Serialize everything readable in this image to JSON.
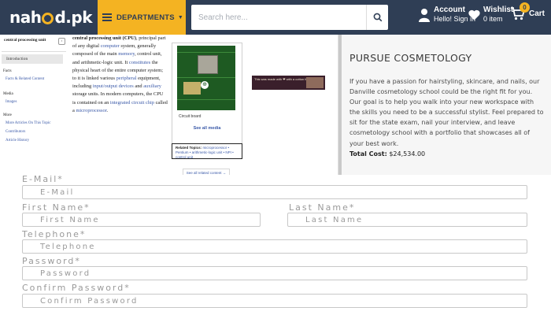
{
  "header": {
    "logo_text_pre": "nah",
    "logo_text_post": "d.pk",
    "departments_label": "DEPARTMENTS",
    "search_placeholder": "Search here...",
    "account_title": "Account",
    "account_sub": "Hello! Sign in",
    "wishlist_title": "Wishlist",
    "wishlist_sub": "0 item",
    "cart_label": "Cart",
    "cart_count": "0",
    "colors": {
      "bar": "#2f3e55",
      "accent": "#f4b322"
    }
  },
  "encyclopedia": {
    "toc_title": "central processing unit",
    "toc_active": "Introduction",
    "toc_facts_head": "Facts",
    "toc_facts_item": "Facts & Related Content",
    "toc_media_head": "Media",
    "toc_media_item": "Images",
    "toc_more_head": "More",
    "toc_more_items": [
      "More Articles On This Topic",
      "Contributors",
      "Article History"
    ],
    "article": [
      {
        "t": "central processing unit (CPU)",
        "b": true
      },
      {
        "t": ", principal part of any digital "
      },
      {
        "t": "computer",
        "l": true
      },
      {
        "t": " system, generally composed of the main "
      },
      {
        "t": "memory",
        "l": true
      },
      {
        "t": ", control unit, and arithmetic-logic unit. It "
      },
      {
        "t": "constitutes",
        "l": true
      },
      {
        "t": " the physical heart of the entire computer system; to it is linked various "
      },
      {
        "t": "peripheral",
        "l": true
      },
      {
        "t": " equipment, including "
      },
      {
        "t": "input/output devices",
        "l": true
      },
      {
        "t": " and "
      },
      {
        "t": "auxiliary",
        "l": true
      },
      {
        "t": " storage units. In modern computers, the CPU is contained on an "
      },
      {
        "t": "integrated circuit chip",
        "l": true
      },
      {
        "t": " called a "
      },
      {
        "t": "microprocessor",
        "l": true
      },
      {
        "t": "."
      }
    ],
    "figure_caption": "Circuit board",
    "figure_see_all": "See all media",
    "related_label": "Related Topics:",
    "related_topics": "microprocessor • Pentium • arithmetic-logic unit • NPI • control unit",
    "related_button": "See all related content →",
    "ad_text": "This was made with ❤ with a cotton feel!"
  },
  "cosmetology": {
    "title": "PURSUE COSMETOLOGY",
    "body": "If you have a passion for hairstyling, skincare, and nails, our Danville cosmetology school could be the right fit for you. Our goal is to help you walk into your new workspace with the skills you need to be a successful stylist. Feel prepared to sit for the state exam, nail your interview, and leave cosmetology school with a portfolio that showcases all of your best work.",
    "cost_label": "Total Cost:",
    "cost_value": "$24,534.00"
  },
  "form": {
    "email_label": "E-Mail*",
    "email_placeholder": "E-Mail",
    "first_label": "First Name*",
    "first_placeholder": "First Name",
    "last_label": "Last Name*",
    "last_placeholder": "Last Name",
    "phone_label": "Telephone*",
    "phone_placeholder": "Telephone",
    "password_label": "Password*",
    "password_placeholder": "Password",
    "confirm_label": "Confirm Password*",
    "confirm_placeholder": "Confirm Password"
  }
}
